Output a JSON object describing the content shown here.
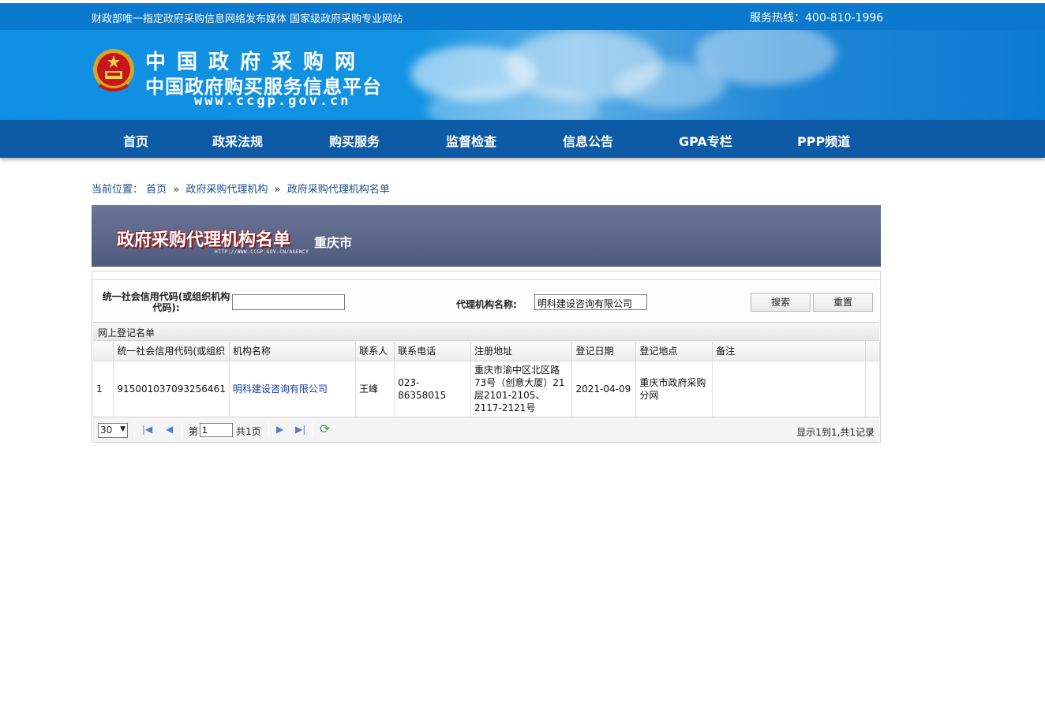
{
  "topbar": {
    "left_text": "财政部唯一指定政府采购信息网络发布媒体 国家级政府采购专业网站",
    "hotline": "服务热线：400-810-1996"
  },
  "logo": {
    "title1": "中国政府采购网",
    "title2": "中国政府购买服务信息平台",
    "url": "www.ccgp.gov.cn"
  },
  "nav": [
    "首页",
    "政采法规",
    "购买服务",
    "监督检查",
    "信息公告",
    "GPA专栏",
    "PPP频道"
  ],
  "breadcrumb": {
    "prefix": "当前位置：",
    "items": [
      "首页",
      "政府采购代理机构",
      "政府采购代理机构名单"
    ],
    "sep": "»"
  },
  "header": {
    "title": "政府采购代理机构名单",
    "subtitle_en": "HTTP://WWW.CCGP.GOV.CN/AGENCY",
    "city": "重庆市"
  },
  "search": {
    "code_label": "统一社会信用代码(或组织机构代码):",
    "code_value": "",
    "name_label": "代理机构名称:",
    "name_value": "明科建设咨询有限公司",
    "search_button": "搜索",
    "reset_button": "重置"
  },
  "grid": {
    "title": "网上登记名单",
    "columns": [
      "",
      "统一社会信用代码(或组织",
      "机构名称",
      "联系人",
      "联系电话",
      "注册地址",
      "登记日期",
      "登记地点",
      "备注"
    ],
    "rows": [
      {
        "num": "1",
        "code": "915001037093256461",
        "name": "明科建设咨询有限公司",
        "contact": "王峰",
        "phone": "023-86358015",
        "address": "重庆市渝中区北区路73号（创意大厦）21层2101-2105、2117-2121号",
        "date": "2021-04-09",
        "place": "重庆市政府采购分网",
        "remark": ""
      }
    ]
  },
  "pager": {
    "page_size": "30",
    "page_label": "第",
    "page_value": "1",
    "total_pages": "共1页",
    "summary": "显示1到1,共1记录"
  }
}
